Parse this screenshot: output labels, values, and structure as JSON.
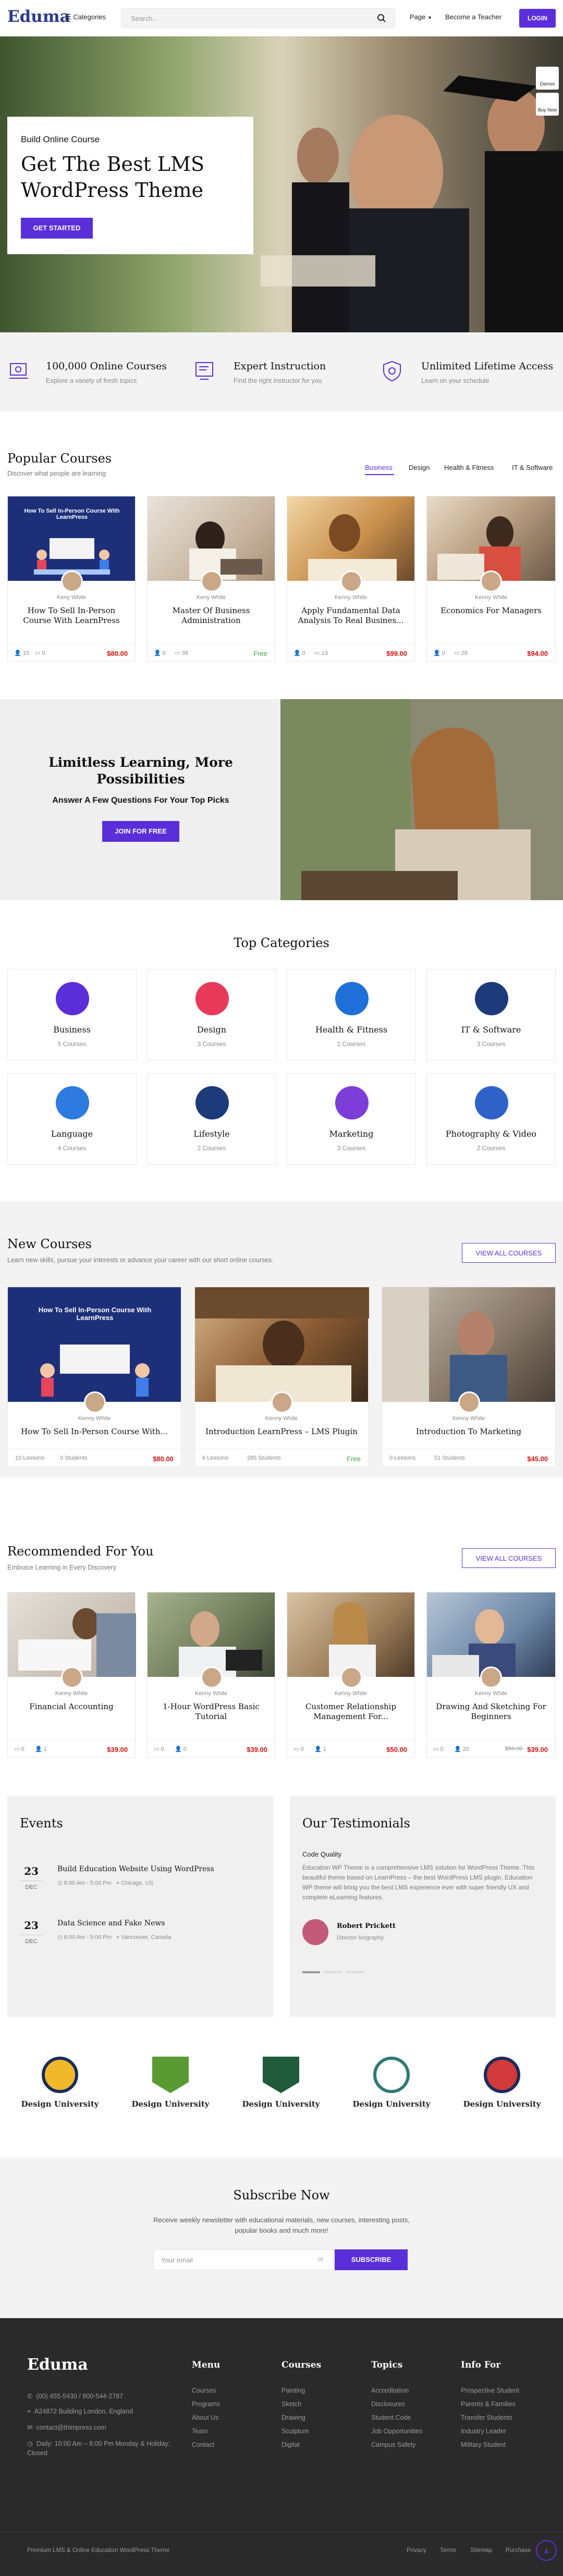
{
  "header": {
    "logo": "Eduma",
    "categories_label": "Categories",
    "search_placeholder": "Search...",
    "nav_page": "Page",
    "nav_teacher": "Become a Teacher",
    "login": "LOGIN",
    "side_demos": "Demos",
    "side_buy": "Buy Now"
  },
  "hero": {
    "subtitle": "Build Online Course",
    "title": "Get The Best LMS WordPress Theme",
    "cta": "GET STARTED"
  },
  "features": [
    {
      "title": "100,000 Online Courses",
      "subtitle": "Explore a variety of fresh topics"
    },
    {
      "title": "Expert Instruction",
      "subtitle": "Find the right instructor for you"
    },
    {
      "title": "Unlimited Lifetime Access",
      "subtitle": "Learn on your schedule"
    }
  ],
  "popular": {
    "title": "Popular Courses",
    "subtitle": "Discover what people are learning",
    "tabs": [
      "Business",
      "Design",
      "Health & Fitness",
      "IT & Software"
    ],
    "courses": [
      {
        "author": "Keny White",
        "title": "How To Sell In-Person Course With LearnPress",
        "students": "15",
        "lessons": "0",
        "price": "$80.00",
        "img_text": "How To Sell In-Person Course With LearnPress"
      },
      {
        "author": "Keny White",
        "title": "Master Of Business Administration",
        "students": "0",
        "lessons": "39",
        "price": "Free"
      },
      {
        "author": "Kenny White",
        "title": "Apply Fundamental Data Analysis To Real Busines...",
        "students": "0",
        "lessons": "13",
        "price": "$99.00"
      },
      {
        "author": "Kenny White",
        "title": "Economics For Managers",
        "students": "0",
        "lessons": "28",
        "price": "$94.00"
      }
    ]
  },
  "promo": {
    "title": "Limitless Learning, More Possibilities",
    "subtitle": "Answer A Few Questions For Your Top Picks",
    "cta": "JOIN FOR FREE"
  },
  "top_categories": {
    "title": "Top Categories",
    "items": [
      {
        "name": "Business",
        "count": "5 Courses",
        "color": "#5a2fd9"
      },
      {
        "name": "Design",
        "count": "3 Courses",
        "color": "#e8395a"
      },
      {
        "name": "Health & Fitness",
        "count": "1 Courses",
        "color": "#1e6fd9"
      },
      {
        "name": "IT & Software",
        "count": "3 Courses",
        "color": "#1d3b7a"
      },
      {
        "name": "Language",
        "count": "4 Courses",
        "color": "#2d7be0"
      },
      {
        "name": "Lifestyle",
        "count": "2 Courses",
        "color": "#1d3b7a"
      },
      {
        "name": "Marketing",
        "count": "3 Courses",
        "color": "#7d3dd9"
      },
      {
        "name": "Photography & Video",
        "count": "2 Courses",
        "color": "#2f62c9"
      }
    ]
  },
  "new_courses": {
    "title": "New Courses",
    "subtitle": "Learn new skills, pursue your interests or advance your career with our short online courses.",
    "view_all": "VIEW ALL COURSES",
    "courses": [
      {
        "author": "Kenny White",
        "title": "How To Sell In-Person Course With...",
        "lessons": "10 Lessons",
        "students": "0 Students",
        "price": "$80.00",
        "img_text": "How To Sell In-Person Course With LearnPress"
      },
      {
        "author": "Kenny White",
        "title": "Introduction LearnPress – LMS Plugin",
        "lessons": "6 Lessons",
        "students": "285 Students",
        "price": "Free"
      },
      {
        "author": "Kenny White",
        "title": "Introduction To Marketing",
        "lessons": "0 Lessons",
        "students": "51 Students",
        "price": "$45.00"
      }
    ]
  },
  "recommended": {
    "title": "Recommended For You",
    "subtitle": "Embrace Learning in Every Discovery",
    "view_all": "VIEW ALL COURSES",
    "courses": [
      {
        "author": "Kenny White",
        "title": "Financial Accounting",
        "lessons": "0",
        "students": "1",
        "price": "$39.00"
      },
      {
        "author": "Kenny White",
        "title": "1-Hour WordPress Basic Tutorial",
        "lessons": "0",
        "students": "0",
        "price": "$39.00"
      },
      {
        "author": "Kenny White",
        "title": "Customer Relationship Management For...",
        "lessons": "0",
        "students": "1",
        "price": "$50.00"
      },
      {
        "author": "Kenny White",
        "title": "Drawing And Sketching For Beginners",
        "lessons": "0",
        "students": "20",
        "old_price": "$50.00",
        "price": "$39.00"
      }
    ]
  },
  "events": {
    "title": "Events",
    "items": [
      {
        "day": "23",
        "month": "DEC",
        "title": "Build Education Website Using WordPress",
        "time": "8:00 Am - 5:00 Pm",
        "location": "Chicago, US"
      },
      {
        "day": "23",
        "month": "DEC",
        "title": "Data Science and Fake News",
        "time": "8:00 Am - 5:00 Pm",
        "location": "Vancouver, Canada"
      }
    ]
  },
  "testimonials": {
    "title": "Our Testimonials",
    "quote_title": "Code Quality",
    "quote": "Education WP Theme is a comprehensive LMS solution for WordPress Theme. This beautiful theme based on LearnPress – the best WordPress LMS plugin. Education WP theme will bring you the best LMS experience ever with super friendly UX and complete eLearning features.",
    "name": "Robert Prickett",
    "role": "Director biography"
  },
  "universities": [
    {
      "name": "Design University",
      "color": "#f1b829"
    },
    {
      "name": "Design University",
      "color": "#5a9a32"
    },
    {
      "name": "Design University",
      "color": "#1f5a3a"
    },
    {
      "name": "Design University",
      "color": "#2f7a72"
    },
    {
      "name": "Design University",
      "color": "#d2393a"
    }
  ],
  "subscribe": {
    "title": "Subscribe Now",
    "text": "Receive weekly newsletter with educational materials, new courses, interesting posts, popular books and much more!",
    "placeholder": "Your email",
    "button": "SUBSCRIBE"
  },
  "footer": {
    "logo": "Eduma",
    "contact": [
      "(00) 455-5430 / 800-544-2787",
      "A24872 Building London, England",
      "contact@thimpress.com",
      "Daily: 10:00 Am – 8:00 Pm Monday & Holiday: Closed"
    ],
    "columns": [
      {
        "title": "Menu",
        "links": [
          "Courses",
          "Programs",
          "About Us",
          "Team",
          "Contact"
        ]
      },
      {
        "title": "Courses",
        "links": [
          "Painting",
          "Sketch",
          "Drawing",
          "Sculpture",
          "Digital"
        ]
      },
      {
        "title": "Topics",
        "links": [
          "Accreditation",
          "Disclosures",
          "Student Code",
          "Job Opportunities",
          "Campus Safety"
        ]
      },
      {
        "title": "Info For",
        "links": [
          "Prospective Student",
          "Parents & Families",
          "Transfer Students",
          "Industry Leader",
          "Military Student"
        ]
      }
    ],
    "copyright": "Premium LMS & Online Education WordPress Theme",
    "bottom_links": [
      "Privacy",
      "Terms",
      "Sitemap",
      "Purchase"
    ]
  }
}
